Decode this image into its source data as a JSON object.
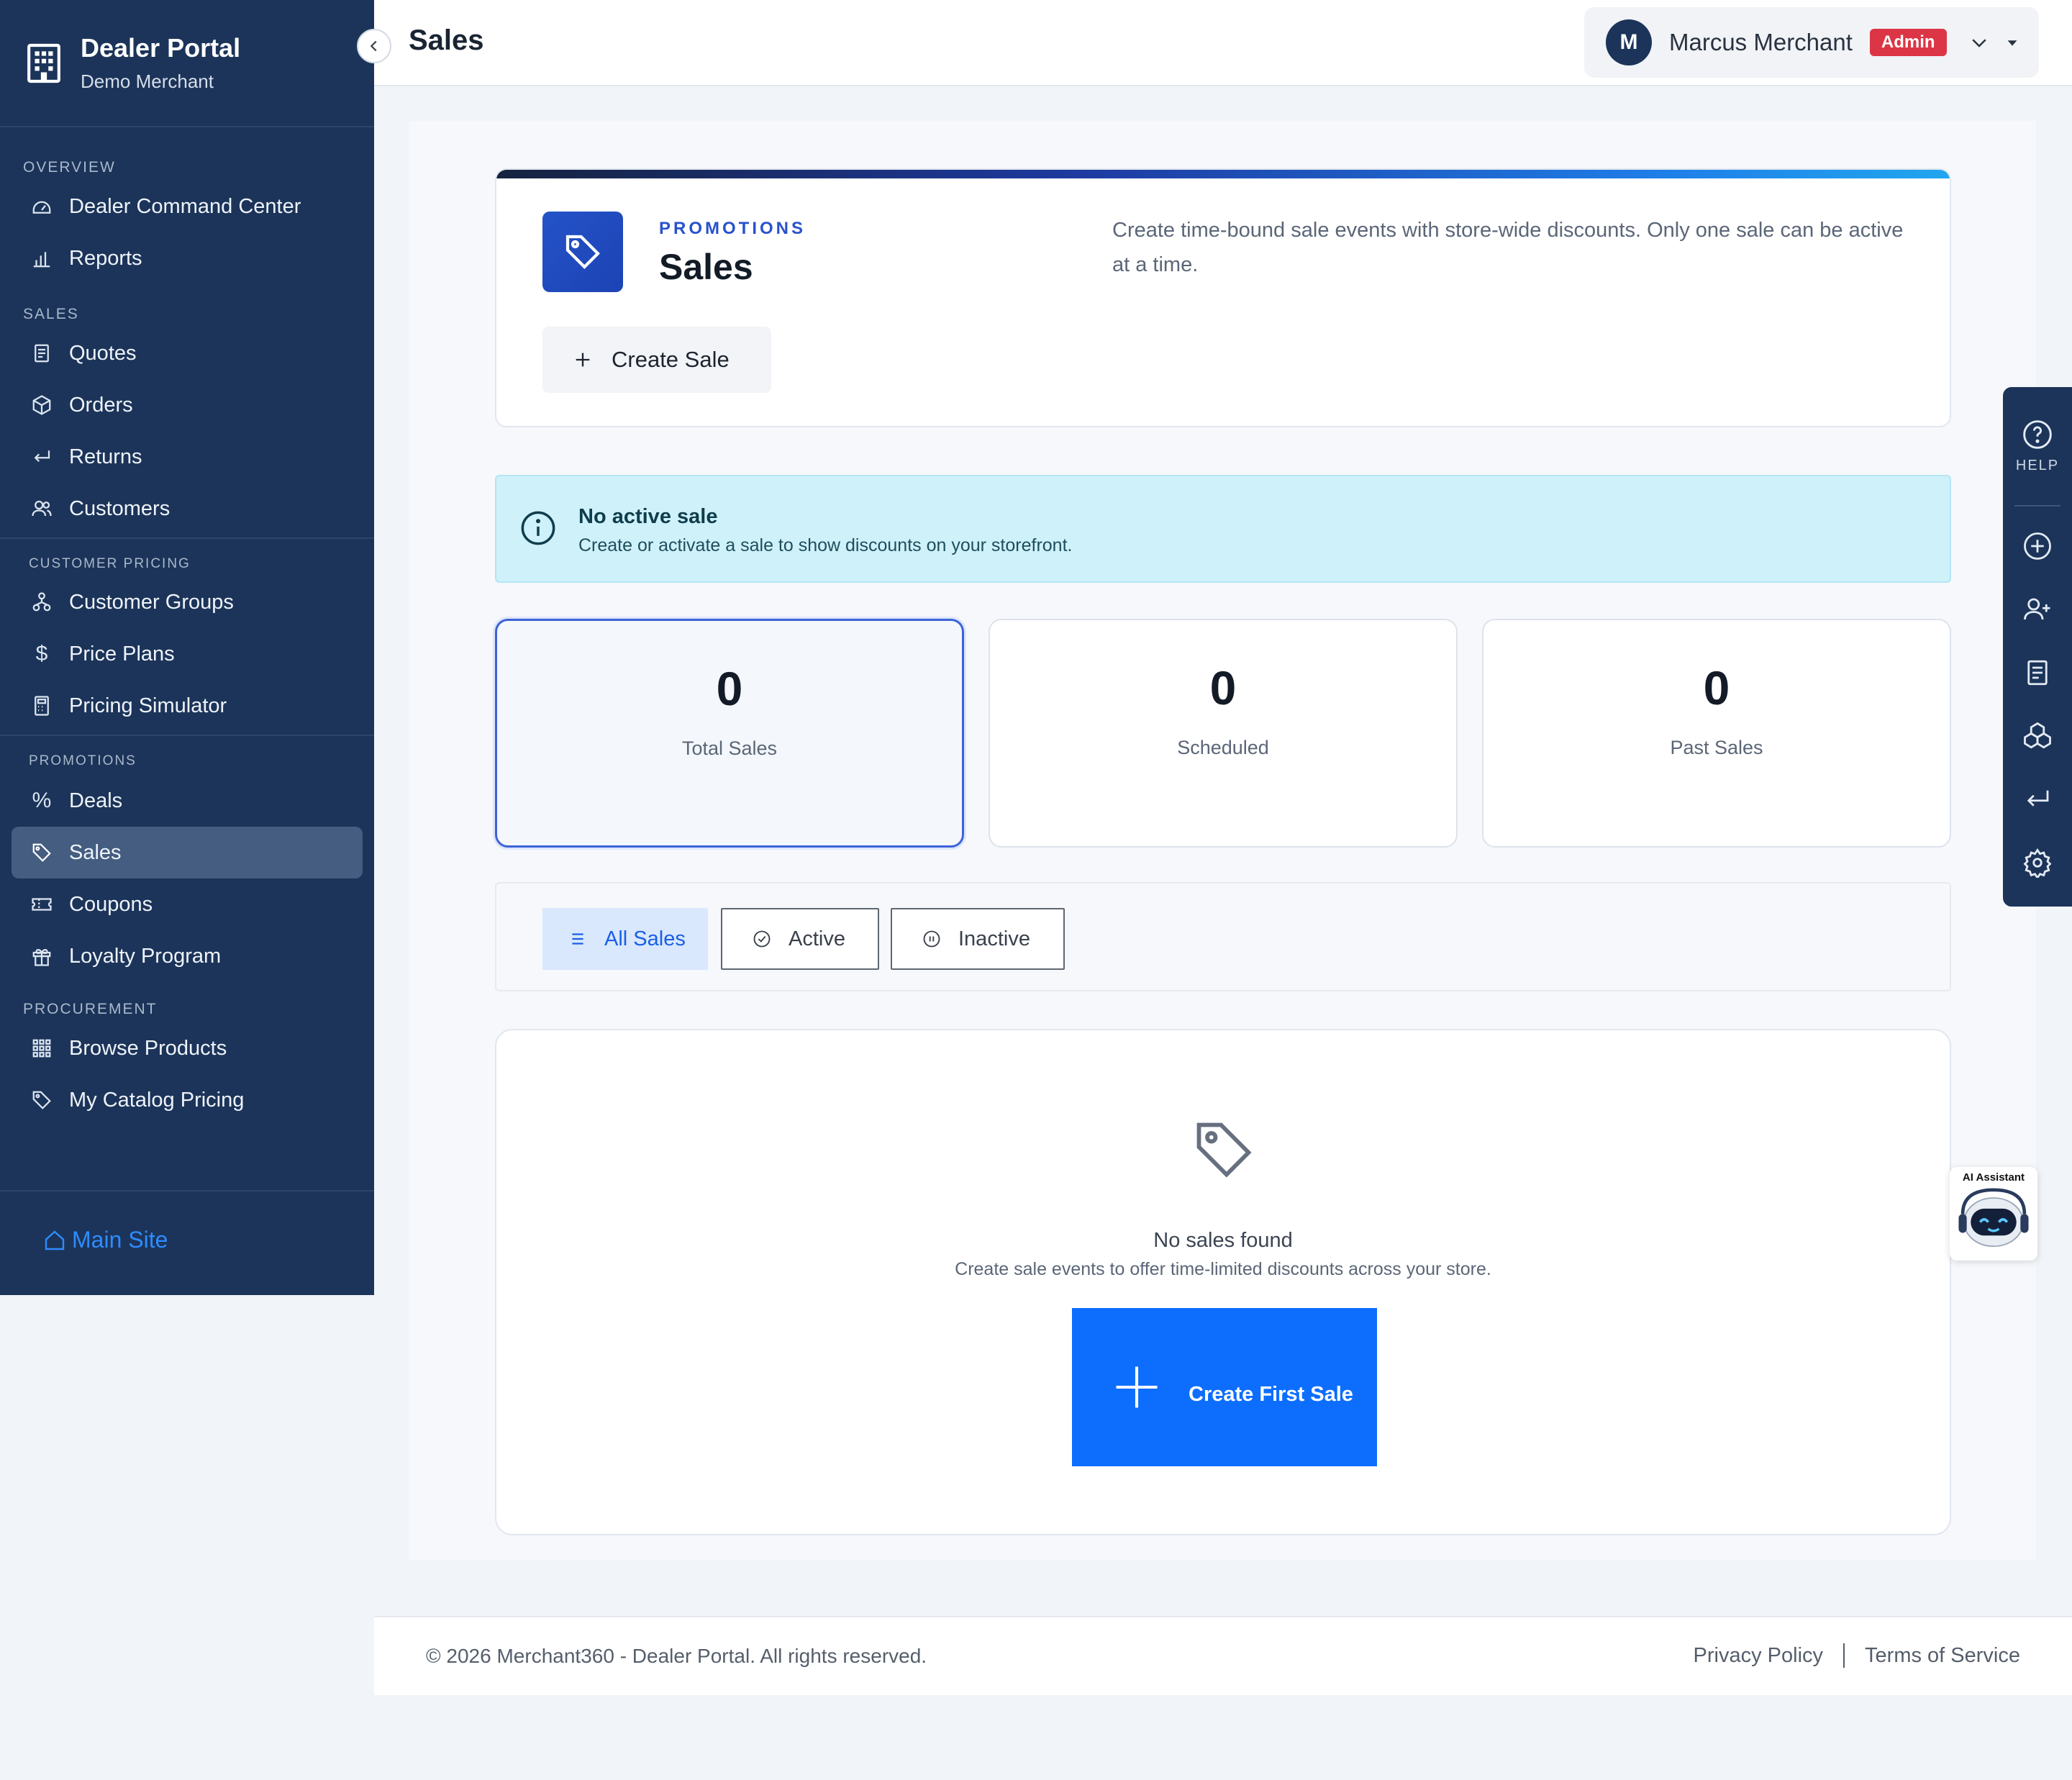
{
  "sidebar": {
    "brand_title": "Dealer Portal",
    "brand_subtitle": "Demo Merchant",
    "sections": {
      "overview": "OVERVIEW",
      "sales": "SALES",
      "customer_pricing": "CUSTOMER PRICING",
      "promotions": "PROMOTIONS",
      "procurement": "PROCUREMENT"
    },
    "items": {
      "dealer_command_center": "Dealer Command Center",
      "reports": "Reports",
      "quotes": "Quotes",
      "orders": "Orders",
      "returns": "Returns",
      "customers": "Customers",
      "customer_groups": "Customer Groups",
      "price_plans": "Price Plans",
      "pricing_simulator": "Pricing Simulator",
      "deals": "Deals",
      "sales": "Sales",
      "coupons": "Coupons",
      "loyalty_program": "Loyalty Program",
      "browse_products": "Browse Products",
      "my_catalog_pricing": "My Catalog Pricing"
    },
    "main_site": "Main Site"
  },
  "header": {
    "title": "Sales",
    "user_initial": "M",
    "user_name": "Marcus Merchant",
    "user_role": "Admin"
  },
  "promo": {
    "label": "PROMOTIONS",
    "title": "Sales",
    "description": "Create time-bound sale events with store-wide discounts. Only one sale can be active at a time.",
    "create_button": "Create Sale"
  },
  "alert": {
    "title": "No active sale",
    "text": "Create or activate a sale to show discounts on your storefront."
  },
  "stats": [
    {
      "value": "0",
      "label": "Total Sales"
    },
    {
      "value": "0",
      "label": "Scheduled"
    },
    {
      "value": "0",
      "label": "Past Sales"
    }
  ],
  "filters": {
    "all": "All Sales",
    "active": "Active",
    "inactive": "Inactive"
  },
  "empty": {
    "title": "No sales found",
    "text": "Create sale events to offer time-limited discounts across your store.",
    "button": "Create First Sale"
  },
  "footer": {
    "copyright": "© 2026 Merchant360 - Dealer Portal. All rights reserved.",
    "privacy": "Privacy Policy",
    "terms": "Terms of Service"
  },
  "dock": {
    "help_label": "HELP"
  },
  "ai_assistant": {
    "label": "AI Assistant"
  },
  "colors": {
    "sidebar": "#1c3459",
    "primary": "#0d6efd",
    "accent": "#2852cc",
    "admin_badge": "#dc3545",
    "alert_bg": "#cff1fa"
  }
}
